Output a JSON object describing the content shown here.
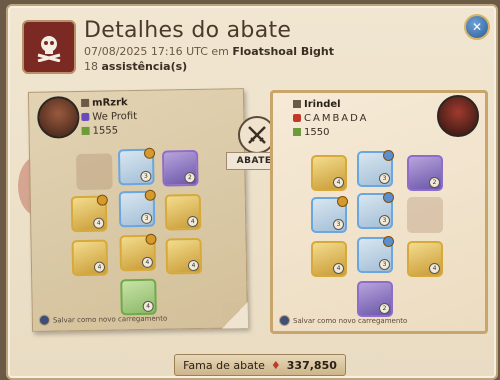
{
  "header": {
    "title": "Detalhes do abate",
    "datetime": "07/08/2025 17:16 UTC em",
    "location": "Floatshoal Bight",
    "assist_count": "18",
    "assist_label": "assistência(s)"
  },
  "killer": {
    "name": "mRzrk",
    "guild": "We Profit",
    "ip": "1555",
    "save_label": "Salvar como novo carregamento"
  },
  "victim": {
    "name": "Irindel",
    "guild": "CAMBADA",
    "ip": "1550",
    "save_label": "Salvar como novo carregamento"
  },
  "center": {
    "killed_label": "ABATEU"
  },
  "footer": {
    "fame_label": "Fama de abate",
    "fame_value": "337,850"
  },
  "colors": {
    "accent": "#c9a46b",
    "blood": "#a83628",
    "close_button": "#2b5b94"
  },
  "icons": [
    "skull-crossbones-icon",
    "close-icon",
    "crossed-swords-icon",
    "guild-icon",
    "item-power-icon",
    "save-loadout-icon",
    "fame-icon"
  ]
}
